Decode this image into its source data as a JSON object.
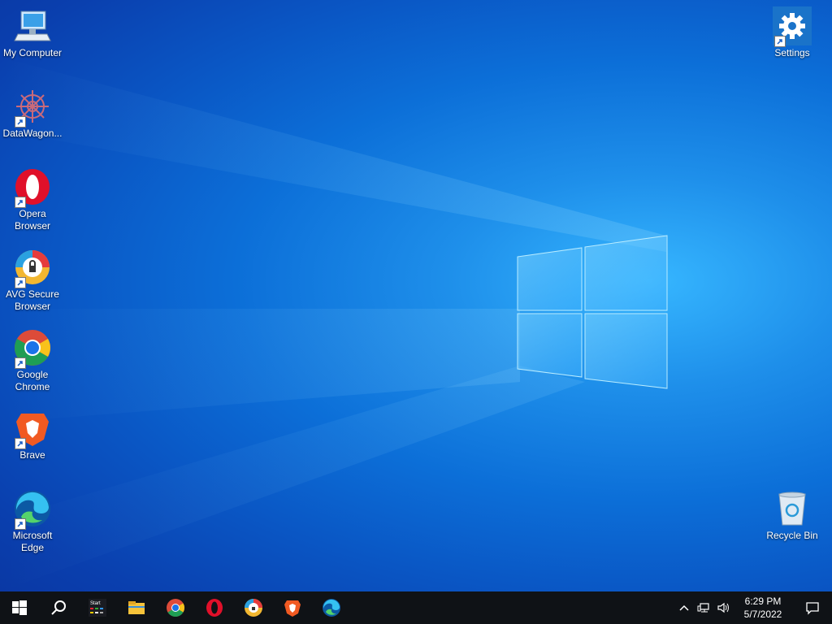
{
  "desktop": {
    "icons": [
      {
        "label": "My Computer",
        "icon": "computer-icon"
      },
      {
        "label": "DataWagon...",
        "icon": "datawagon-icon"
      },
      {
        "label": "Opera\nBrowser",
        "icon": "opera-icon"
      },
      {
        "label": "AVG Secure\nBrowser",
        "icon": "avg-browser-icon"
      },
      {
        "label": "Google\nChrome",
        "icon": "chrome-icon"
      },
      {
        "label": "Brave",
        "icon": "brave-icon"
      },
      {
        "label": "Microsoft\nEdge",
        "icon": "edge-icon"
      },
      {
        "label": "Settings",
        "icon": "settings-gear-icon"
      },
      {
        "label": "Recycle Bin",
        "icon": "recycle-bin-icon"
      }
    ]
  },
  "taskbar": {
    "apps": [
      "start-icon",
      "search-icon",
      "start-app-icon",
      "file-explorer-icon",
      "chrome-icon",
      "opera-icon",
      "avg-browser-icon",
      "brave-icon",
      "edge-icon"
    ],
    "start_app_label": "Start",
    "clock": {
      "time": "6:29 PM",
      "date": "5/7/2022"
    }
  },
  "colors": {
    "taskbar": "#0f1216",
    "accent": "#1e8fea"
  }
}
